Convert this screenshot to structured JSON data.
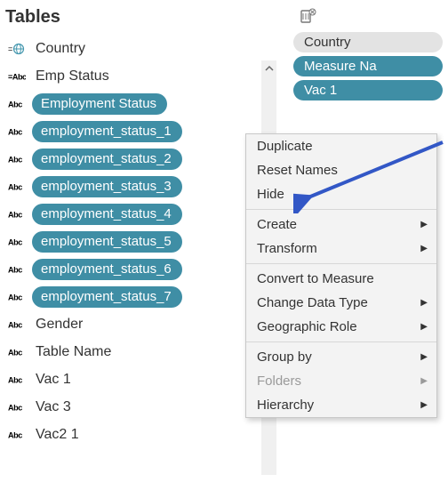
{
  "pane_title": "Tables",
  "fields": [
    {
      "type": "globe",
      "label": "Country",
      "selected": false
    },
    {
      "type": "abc-h",
      "label": "Emp Status",
      "selected": false
    },
    {
      "type": "abc",
      "label": "Employment Status",
      "selected": true
    },
    {
      "type": "abc",
      "label": "employment_status_1",
      "selected": true
    },
    {
      "type": "abc",
      "label": "employment_status_2",
      "selected": true
    },
    {
      "type": "abc",
      "label": "employment_status_3",
      "selected": true
    },
    {
      "type": "abc",
      "label": "employment_status_4",
      "selected": true
    },
    {
      "type": "abc",
      "label": "employment_status_5",
      "selected": true
    },
    {
      "type": "abc",
      "label": "employment_status_6",
      "selected": true
    },
    {
      "type": "abc",
      "label": "employment_status_7",
      "selected": true
    },
    {
      "type": "abc",
      "label": "Gender",
      "selected": false
    },
    {
      "type": "abc",
      "label": "Table Name",
      "selected": false
    },
    {
      "type": "abc",
      "label": "Vac 1",
      "selected": false
    },
    {
      "type": "abc",
      "label": "Vac 3",
      "selected": false
    },
    {
      "type": "abc",
      "label": "Vac2 1",
      "selected": false
    }
  ],
  "shelf": {
    "pills": [
      {
        "style": "gray",
        "label": "Country"
      },
      {
        "style": "blue",
        "label": "Measure Na"
      },
      {
        "style": "blue",
        "label": "Vac 1"
      }
    ]
  },
  "context_menu": {
    "groups": [
      [
        {
          "label": "Duplicate",
          "submenu": false,
          "disabled": false
        },
        {
          "label": "Reset Names",
          "submenu": false,
          "disabled": false
        },
        {
          "label": "Hide",
          "submenu": false,
          "disabled": false
        }
      ],
      [
        {
          "label": "Create",
          "submenu": true,
          "disabled": false
        },
        {
          "label": "Transform",
          "submenu": true,
          "disabled": false
        }
      ],
      [
        {
          "label": "Convert to Measure",
          "submenu": false,
          "disabled": false
        },
        {
          "label": "Change Data Type",
          "submenu": true,
          "disabled": false
        },
        {
          "label": "Geographic Role",
          "submenu": true,
          "disabled": false
        }
      ],
      [
        {
          "label": "Group by",
          "submenu": true,
          "disabled": false
        },
        {
          "label": "Folders",
          "submenu": true,
          "disabled": true
        },
        {
          "label": "Hierarchy",
          "submenu": true,
          "disabled": false
        }
      ]
    ]
  },
  "colors": {
    "pill": "#3f8ea5",
    "arrow": "#3257c6"
  }
}
